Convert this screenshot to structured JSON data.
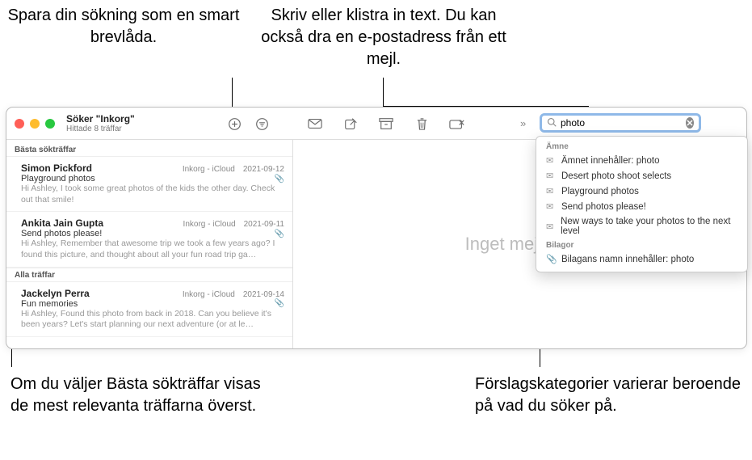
{
  "callouts": {
    "save_smart": "Spara din sökning som en smart brevlåda.",
    "type_paste": "Skriv eller klistra in text. Du kan också dra en e-postadress från ett mejl.",
    "best_hits": "Om du väljer Bästa sökträffar visas de mest relevanta träffarna överst.",
    "categories": "Förslagskategorier varierar beroende på vad du söker på."
  },
  "header": {
    "title": "Söker \"Inkorg\"",
    "subtitle": "Hittade 8 träffar"
  },
  "search": {
    "value": "photo"
  },
  "sections": {
    "best": "Bästa sökträffar",
    "all": "Alla träffar"
  },
  "messages_best": [
    {
      "from": "Simon Pickford",
      "location": "Inkorg - iCloud",
      "date": "2021-09-12",
      "subject": "Playground photos",
      "preview": "Hi Ashley, I took some great photos of the kids the other day. Check out that smile!"
    },
    {
      "from": "Ankita Jain Gupta",
      "location": "Inkorg - iCloud",
      "date": "2021-09-11",
      "subject": "Send photos please!",
      "preview": "Hi Ashley, Remember that awesome trip we took a few years ago? I found this picture, and thought about all your fun road trip ga…"
    }
  ],
  "messages_all": [
    {
      "from": "Jackelyn Perra",
      "location": "Inkorg - iCloud",
      "date": "2021-09-14",
      "subject": "Fun memories",
      "preview": "Hi Ashley, Found this photo from back in 2018. Can you believe it's been years? Let's start planning our next adventure (or at le…"
    }
  ],
  "empty_state": "Inget mejl valt",
  "suggestions": {
    "subject_header": "Ämne",
    "subject_items": [
      "Ämnet innehåller: photo",
      "Desert photo shoot selects",
      "Playground photos",
      "Send photos please!",
      "New ways to take your photos to the next level"
    ],
    "attachments_header": "Bilagor",
    "attachments_items": [
      "Bilagans namn innehåller: photo"
    ]
  }
}
